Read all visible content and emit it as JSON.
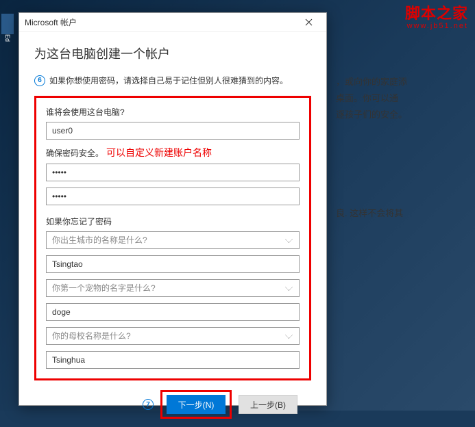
{
  "watermark": {
    "main": "脚本之家",
    "sub": "www.jb51.net"
  },
  "background": {
    "line1": "，或向你的家庭添",
    "line2": "桌面。你可以通",
    "line3": "逐孩子们的安全。",
    "line4": "‎",
    "line5": "良. 这样不会将其"
  },
  "dialog": {
    "title": "Microsoft 帐户",
    "heading": "为这台电脑创建一个帐户",
    "step6": "6",
    "instruction": "如果你想使用密码，请选择自己易于记住但别人很难猜到的内容。",
    "label_who": "谁将会使用这台电脑?",
    "username": "user0",
    "label_password": "确保密码安全。",
    "annotation": "可以自定义新建账户名称",
    "password": "•••••",
    "password_confirm": "•••••",
    "label_forgot": "如果你忘记了密码",
    "q1": "你出生城市的名称是什么?",
    "a1": "Tsingtao",
    "q2": "你第一个宠物的名字是什么?",
    "a2": "doge",
    "q3": "你的母校名称是什么?",
    "a3": "Tsinghua",
    "step7": "7",
    "next": "下一步(N)",
    "back": "上一步(B)"
  }
}
